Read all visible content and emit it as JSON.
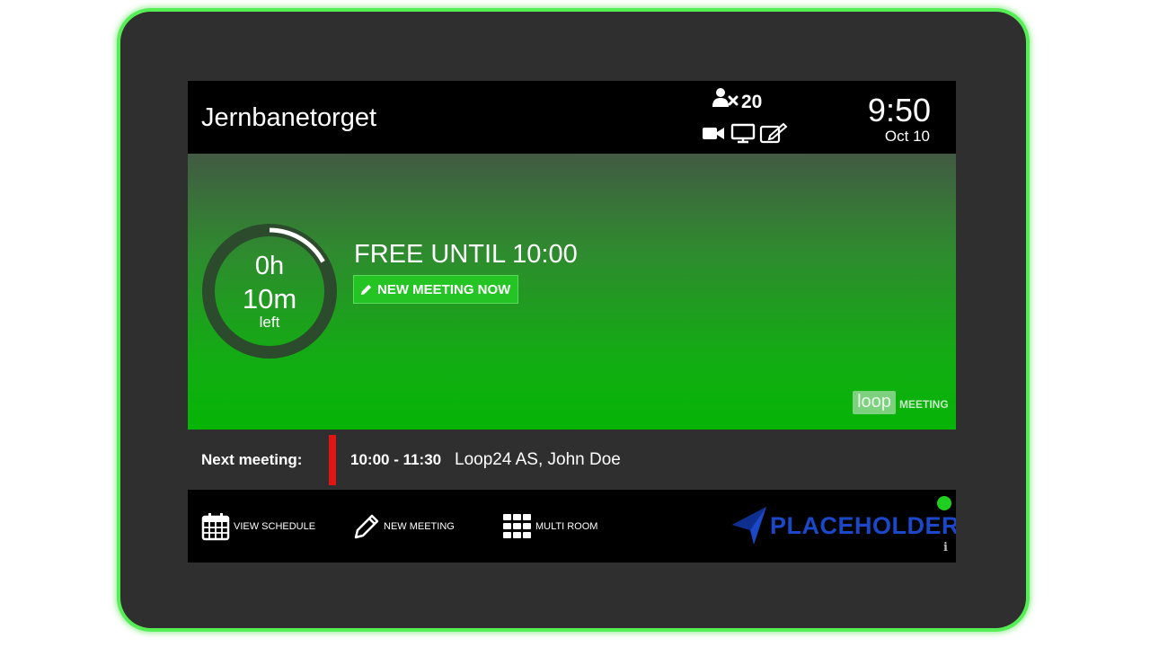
{
  "header": {
    "room_name": "Jernbanetorget",
    "capacity_count": "20",
    "capacity_icon": "person-x-icon",
    "equipment_icons": [
      "video-camera-icon",
      "monitor-icon",
      "whiteboard-icon"
    ],
    "time": "9:50",
    "date": "Oct 10"
  },
  "status": {
    "remaining_hours": "0h",
    "remaining_minutes": "10m",
    "remaining_label": "left",
    "remaining_fraction": 0.17,
    "headline": "FREE UNTIL 10:00",
    "new_meeting_now_label": "NEW MEETING NOW",
    "loop_badge": "loop",
    "meeting_word": "MEETING",
    "colors": {
      "free_green": "#06b406",
      "ring_track": "#2c4a2c",
      "ring_progress": "#ffffff"
    }
  },
  "next_meeting": {
    "label": "Next meeting:",
    "time_range": "10:00 - 11:30",
    "organizer": "Loop24 AS, John Doe",
    "bar_color": "#e01515"
  },
  "footer": {
    "view_schedule_label": "VIEW SCHEDULE",
    "new_meeting_label": "NEW MEETING",
    "multi_room_label": "MULTI ROOM",
    "brand_name": "PLACEHOLDER",
    "brand_color": "#1b48c9",
    "online_indicator_color": "#1fcf1f",
    "info_label": "i"
  },
  "device": {
    "led_color": "#55ee55"
  }
}
